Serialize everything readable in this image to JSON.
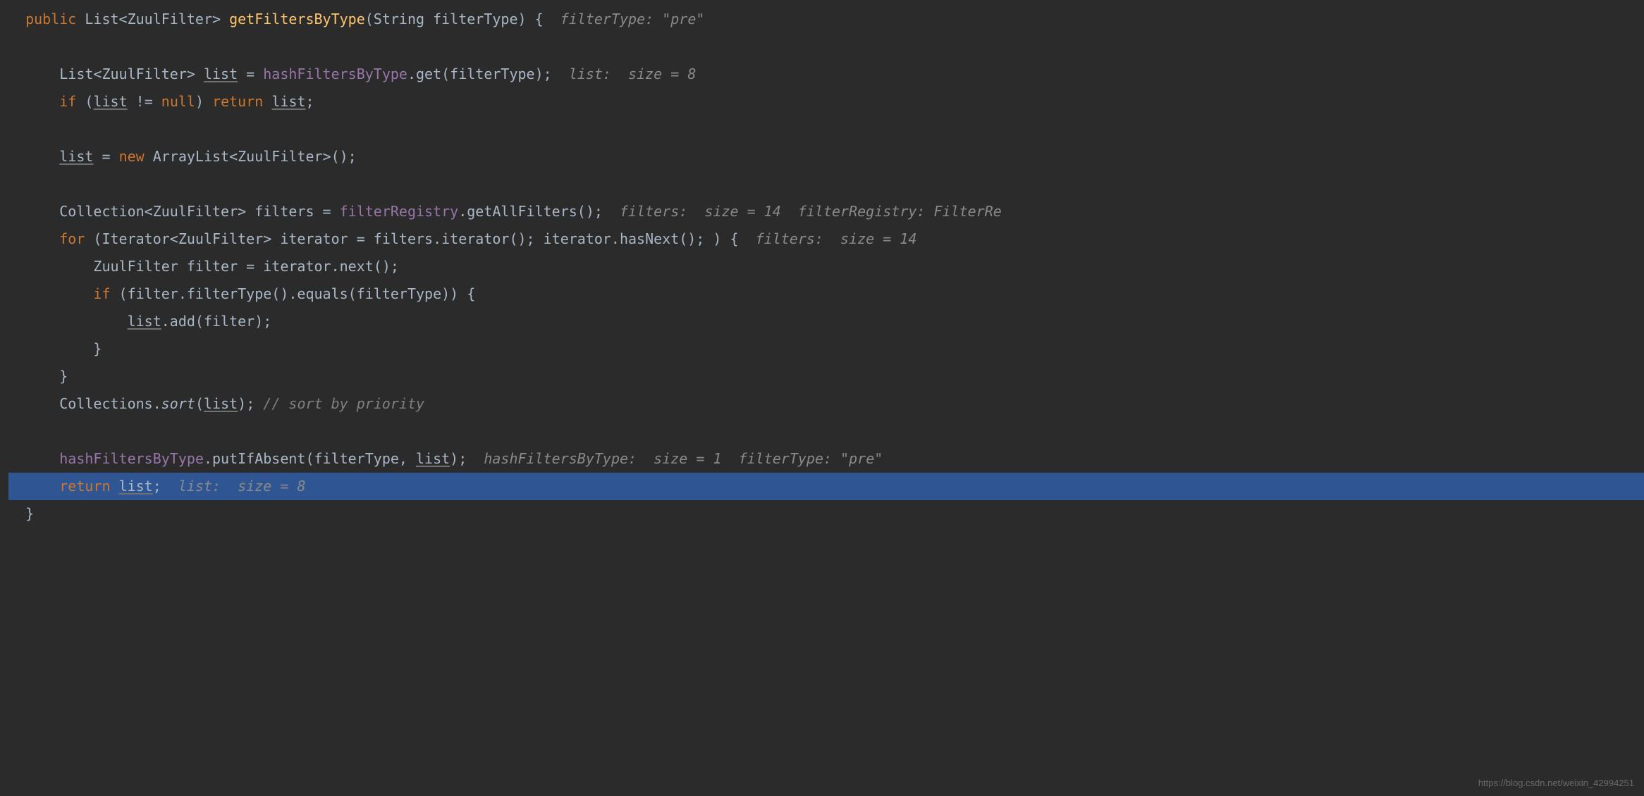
{
  "lines": {
    "l1": {
      "kw_public": "public",
      "type": " List<ZuulFilter> ",
      "method": "getFiltersByType",
      "params": "(String filterType) {",
      "hint": "  filterType: \"pre\""
    },
    "l3": {
      "indent": "    ",
      "text1": "List<ZuulFilter> ",
      "var": "list",
      "text2": " = ",
      "field": "hashFiltersByType",
      "text3": ".get(filterType);",
      "hint": "  list:  size = 8"
    },
    "l4": {
      "indent": "    ",
      "kw_if": "if",
      "text1": " (",
      "var": "list",
      "text2": " != ",
      "kw_null": "null",
      "text3": ") ",
      "kw_return": "return",
      "text4": " ",
      "var2": "list",
      "text5": ";"
    },
    "l6": {
      "indent": "    ",
      "var": "list",
      "text1": " = ",
      "kw_new": "new",
      "text2": " ArrayList<ZuulFilter>();"
    },
    "l8": {
      "indent": "    ",
      "text1": "Collection<ZuulFilter> filters = ",
      "field": "filterRegistry",
      "text2": ".getAllFilters();",
      "hint": "  filters:  size = 14  filterRegistry: FilterRe"
    },
    "l9": {
      "indent": "    ",
      "kw_for": "for",
      "text1": " (Iterator<ZuulFilter> iterator = filters.iterator(); iterator.hasNext(); ) {",
      "hint": "  filters:  size = 14"
    },
    "l10": {
      "indent": "        ",
      "text1": "ZuulFilter filter = iterator.next();"
    },
    "l11": {
      "indent": "        ",
      "kw_if": "if",
      "text1": " (filter.filterType().equals(filterType)) {"
    },
    "l12": {
      "indent": "            ",
      "var": "list",
      "text1": ".add(filter);"
    },
    "l13": {
      "indent": "        ",
      "text1": "}"
    },
    "l14": {
      "indent": "    ",
      "text1": "}"
    },
    "l15": {
      "indent": "    ",
      "text1": "Collections.",
      "sort": "sort",
      "text2": "(",
      "var": "list",
      "text3": "); ",
      "comment": "// sort by priority"
    },
    "l17": {
      "indent": "    ",
      "field": "hashFiltersByType",
      "text1": ".putIfAbsent(filterType, ",
      "var": "list",
      "text2": ");",
      "hint": "  hashFiltersByType:  size = 1  filterType: \"pre\""
    },
    "l18": {
      "indent": "    ",
      "kw_return": "return",
      "text1": " ",
      "var": "list",
      "text2": ";",
      "hint": "  list:  size = 8"
    },
    "l19": {
      "text1": "}"
    }
  },
  "watermark": "https://blog.csdn.net/weixin_42994251"
}
